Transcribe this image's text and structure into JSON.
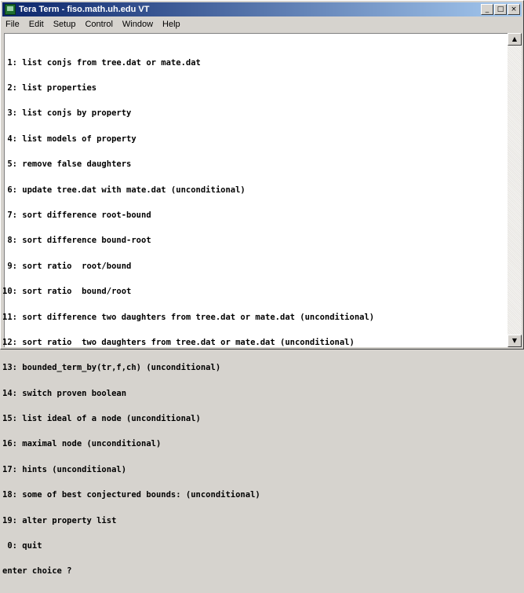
{
  "window": {
    "title": "Tera Term - fiso.math.uh.edu VT",
    "buttons": {
      "minimize": "_",
      "maximize": "□",
      "close": "×"
    }
  },
  "menu": {
    "items": [
      {
        "label": "File"
      },
      {
        "label": "Edit"
      },
      {
        "label": "Setup"
      },
      {
        "label": "Control"
      },
      {
        "label": "Window"
      },
      {
        "label": "Help"
      }
    ]
  },
  "terminal": {
    "lines": [
      " 1: list conjs from tree.dat or mate.dat",
      " 2: list properties",
      " 3: list conjs by property",
      " 4: list models of property",
      " 5: remove false daughters",
      " 6: update tree.dat with mate.dat (unconditional)",
      " 7: sort difference root-bound",
      " 8: sort difference bound-root",
      " 9: sort ratio  root/bound",
      "10: sort ratio  bound/root",
      "11: sort difference two daughters from tree.dat or mate.dat (unconditional)",
      "12: sort ratio  two daughters from tree.dat or mate.dat (unconditional)",
      "13: bounded_term_by(tr,f,ch) (unconditional)",
      "14: switch proven boolean",
      "15: list ideal of a node (unconditional)",
      "16: maximal node (unconditional)",
      "17: hints (unconditional)",
      "18: some of best conjectured bounds: (unconditional)",
      "19: alter property list",
      " 0: quit",
      "enter choice ?"
    ]
  },
  "scrollbar": {
    "up_arrow": "▲",
    "down_arrow": "▼"
  },
  "colors": {
    "titlebar_start": "#0a246a",
    "titlebar_end": "#a6caf0",
    "chrome": "#d6d3ce",
    "terminal_bg": "#ffffff",
    "terminal_fg": "#000000"
  }
}
